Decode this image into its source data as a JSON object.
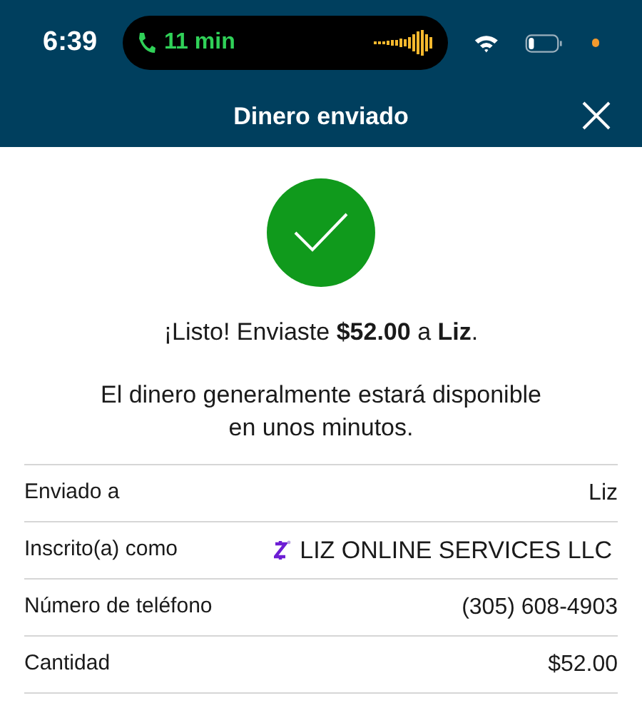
{
  "status_bar": {
    "time": "6:39",
    "call_duration": "11 min"
  },
  "header": {
    "title": "Dinero enviado"
  },
  "confirmation": {
    "message": "¡Listo! Enviaste **$52.00** a **Liz**.",
    "note": "El dinero generalmente estará disponible en unos minutos."
  },
  "details": [
    {
      "kind": "plain",
      "label": "Enviado a",
      "value": "Liz"
    },
    {
      "kind": "enrolled",
      "label": "Inscrito(a) como",
      "value": "LIZ ONLINE SERVICES LLC"
    },
    {
      "kind": "plain",
      "label": "Número de teléfono",
      "value": "(305) 608-4903"
    },
    {
      "kind": "plain",
      "label": "Cantidad",
      "value": "$52.00"
    }
  ]
}
